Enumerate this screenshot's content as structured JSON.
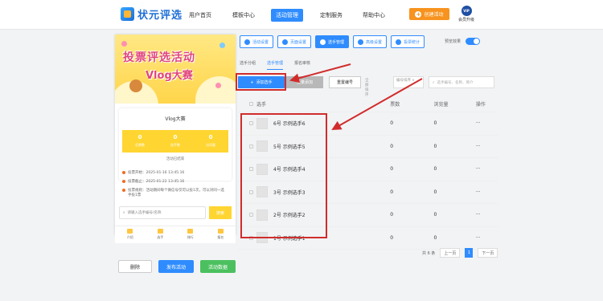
{
  "nav": {
    "logo_text": "状元评选",
    "items": [
      "用户首页",
      "模板中心",
      "活动管理",
      "定制服务",
      "帮助中心"
    ],
    "cta": "创建活动",
    "vip_badge": "VIP",
    "vip_label": "会员升级"
  },
  "preview": {
    "banner_line1": "投票评选活动",
    "banner_line2": "Vlog大赛",
    "card_title": "Vlog大赛",
    "stats": [
      {
        "num": "0",
        "label": "总票数"
      },
      {
        "num": "0",
        "label": "选手数"
      },
      {
        "num": "0",
        "label": "访问量"
      }
    ],
    "status": "活动已结束",
    "rules": [
      "投票开始：2025-01-16 13:45:16",
      "投票截止：2025-01-22 13:45:16",
      "投票规则：活动期间每个微信号仅可以投1次，可以对同一选手投1票"
    ],
    "search_placeholder": "请输入选手编号/名称",
    "search_btn": "搜索",
    "tabs": [
      "介绍",
      "选手",
      "排行",
      "报名"
    ]
  },
  "bottom_buttons": {
    "delete": "删除",
    "publish": "发布活动",
    "data": "活动数据"
  },
  "toolbar": {
    "tools": [
      "活动设置",
      "页面设置",
      "选手管理",
      "高级设置",
      "投票统计"
    ],
    "preview_label": "预览效果"
  },
  "subtabs": [
    "选手分组",
    "选手管理",
    "报名审核"
  ],
  "actions": {
    "add": "添加选手",
    "batch": "批量添加",
    "reset": "重置编号",
    "sort_label": "全部排序",
    "sort_value": "编号排序 ∨",
    "search_placeholder": "选手编号、名称、简介"
  },
  "table": {
    "headers": [
      "选手",
      "票数",
      "浏览量",
      "操作"
    ],
    "rows": [
      {
        "name": "6号  示例选手6",
        "votes": "0",
        "views": "0",
        "ops": "···"
      },
      {
        "name": "5号  示例选手5",
        "votes": "0",
        "views": "0",
        "ops": "···"
      },
      {
        "name": "4号  示例选手4",
        "votes": "0",
        "views": "0",
        "ops": "···"
      },
      {
        "name": "3号  示例选手3",
        "votes": "0",
        "views": "0",
        "ops": "···"
      },
      {
        "name": "2号  示例选手2",
        "votes": "0",
        "views": "0",
        "ops": "···"
      },
      {
        "name": "1号  示例选手1",
        "votes": "0",
        "views": "0",
        "ops": "···"
      }
    ]
  },
  "pager": {
    "total": "共 6 条",
    "prev": "上一页",
    "current": "1",
    "next": "下一页"
  },
  "colors": {
    "primary": "#2f8cff",
    "accent": "#f7931e",
    "highlight": "#d12c2c",
    "yellow": "#ffd531"
  }
}
